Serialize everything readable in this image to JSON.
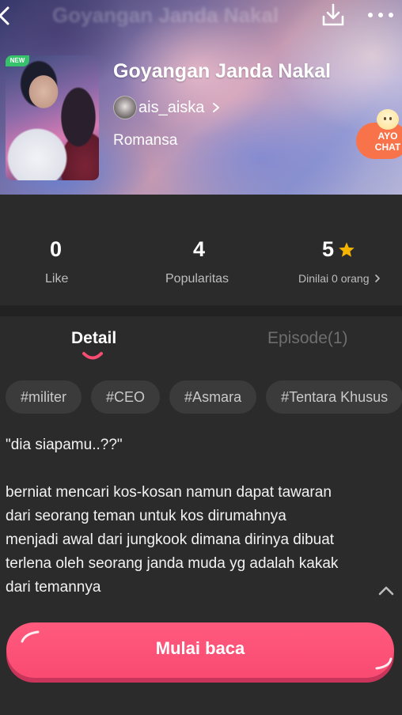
{
  "header": {
    "ghost_title": "Goyangan Janda Nakal",
    "cover_badge": "NEW",
    "title": "Goyangan Janda Nakal",
    "author": "ais_aiska",
    "genre": "Romansa",
    "chat_bubble": "AYO CHAT",
    "icons": {
      "back": "chevron-left-icon",
      "download": "download-icon",
      "more": "more-horizontal-icon",
      "author_chevron": "chevron-right-icon"
    }
  },
  "stats": {
    "like": {
      "value": "0",
      "label": "Like"
    },
    "popularity": {
      "value": "4",
      "label": "Popularitas"
    },
    "rating": {
      "value": "5",
      "label": "Dinilai 0 orang",
      "star_color": "#f5b400"
    }
  },
  "tabs": {
    "detail": "Detail",
    "episode": "Episode(1)"
  },
  "tags": [
    "#militer",
    "#CEO",
    "#Asmara",
    "#Tentara Khusus"
  ],
  "description": {
    "quote": "\"dia siapamu..??\"",
    "lines": [
      "berniat mencari kos-kosan namun dapat tawaran",
      "dari seorang teman untuk kos dirumahnya",
      "menjadi awal dari jungkook dimana dirinya dibuat",
      "terlena oleh seorang janda muda yg adalah kakak",
      "dari temannya"
    ]
  },
  "cta": {
    "label": "Mulai baca"
  },
  "colors": {
    "accent": "#fa4b72",
    "background": "#2b2b2b",
    "tag_bg": "#3b3b3b",
    "new_badge": "#35c26b",
    "chat_bubble": "#f9734a"
  }
}
